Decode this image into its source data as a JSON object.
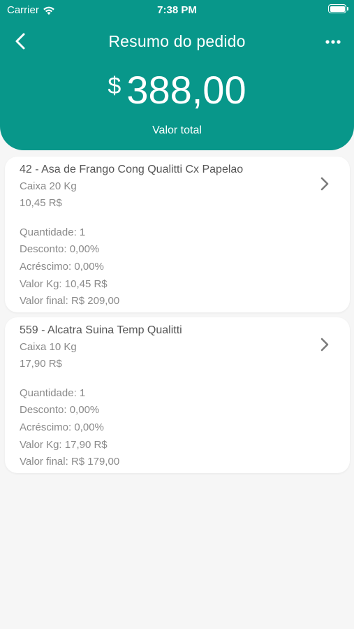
{
  "status_bar": {
    "carrier": "Carrier",
    "time": "7:38 PM"
  },
  "nav": {
    "title": "Resumo do pedido",
    "back_icon": "chevron-left-icon",
    "more_icon": "ellipsis-icon"
  },
  "total": {
    "currency": "$",
    "amount": "388,00",
    "label": "Valor total"
  },
  "colors": {
    "header": "#08978a",
    "background": "#f6f6f6",
    "card": "#ffffff"
  },
  "items": [
    {
      "title": "42 - Asa de Frango Cong Qualitti Cx Papelao",
      "package": "Caixa 20 Kg",
      "price": "10,45 R$",
      "quantity_label": "Quantidade:",
      "quantity": "1",
      "discount_label": "Desconto:",
      "discount": "0,00%",
      "surcharge_label": "Acréscimo:",
      "surcharge": "0,00%",
      "kg_label": "Valor Kg:",
      "kg_value": "10,45 R$",
      "final_label": "Valor final:",
      "final_value": "R$ 209,00"
    },
    {
      "title": "559 - Alcatra Suina Temp Qualitti",
      "package": "Caixa 10 Kg",
      "price": "17,90 R$",
      "quantity_label": "Quantidade:",
      "quantity": "1",
      "discount_label": "Desconto:",
      "discount": "0,00%",
      "surcharge_label": "Acréscimo:",
      "surcharge": "0,00%",
      "kg_label": "Valor Kg:",
      "kg_value": "17,90 R$",
      "final_label": "Valor final:",
      "final_value": "R$ 179,00"
    }
  ]
}
